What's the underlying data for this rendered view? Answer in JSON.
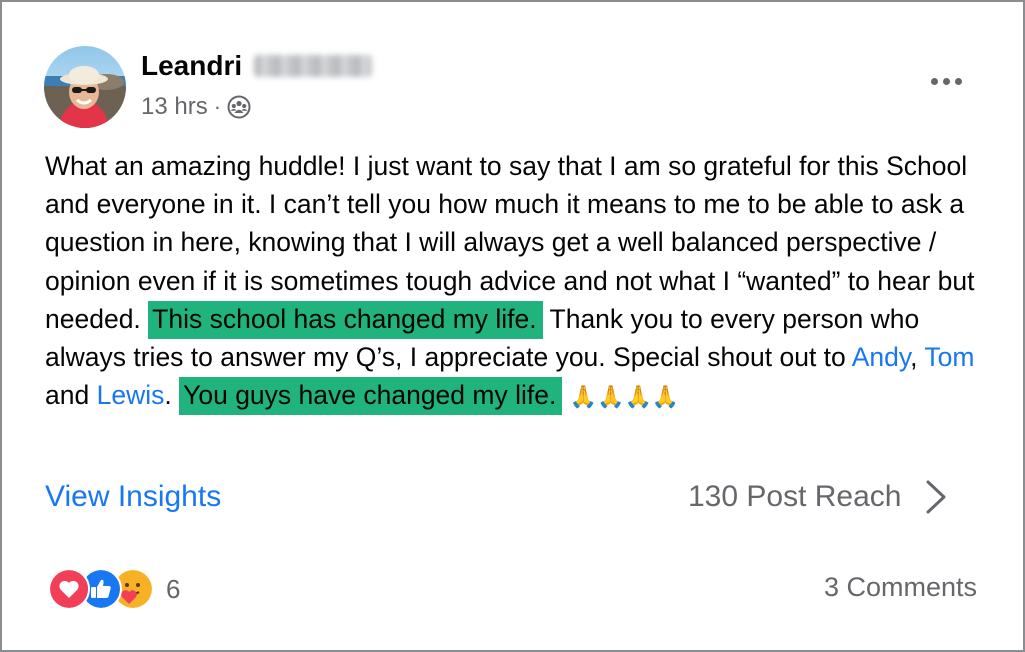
{
  "post": {
    "author_first": "Leandri",
    "time": "13 hrs",
    "separator": "·",
    "audience_icon": "group-icon",
    "more_icon": "more-icon",
    "text_1": "What an amazing huddle! I just want to say that I am so grateful for this School and everyone in it. I can’t tell you how much it means to me to be able to ask a question in here, knowing that I will always get a well balanced perspective / opinion even if it is sometimes tough advice and not what I “wanted” to hear but needed.",
    "highlight_1": "This school has changed my life.",
    "text_2": "Thank you to every person who always tries to answer my Q’s, I appreciate you. Special shout out to",
    "mention_1": "Andy",
    "comma": ",",
    "mention_2": "Tom",
    "and_word": "and",
    "mention_3": "Lewis",
    "period": ".",
    "highlight_2": "You guys have changed my life.",
    "emoji": "🙏🙏🙏🙏"
  },
  "insights": {
    "view_label": "View Insights",
    "reach_label": "130 Post Reach"
  },
  "footer": {
    "reaction_count": "6",
    "comments_label": "3 Comments"
  },
  "colors": {
    "highlight": "#20b37d",
    "link": "#1877f2",
    "muted": "#65676b"
  }
}
